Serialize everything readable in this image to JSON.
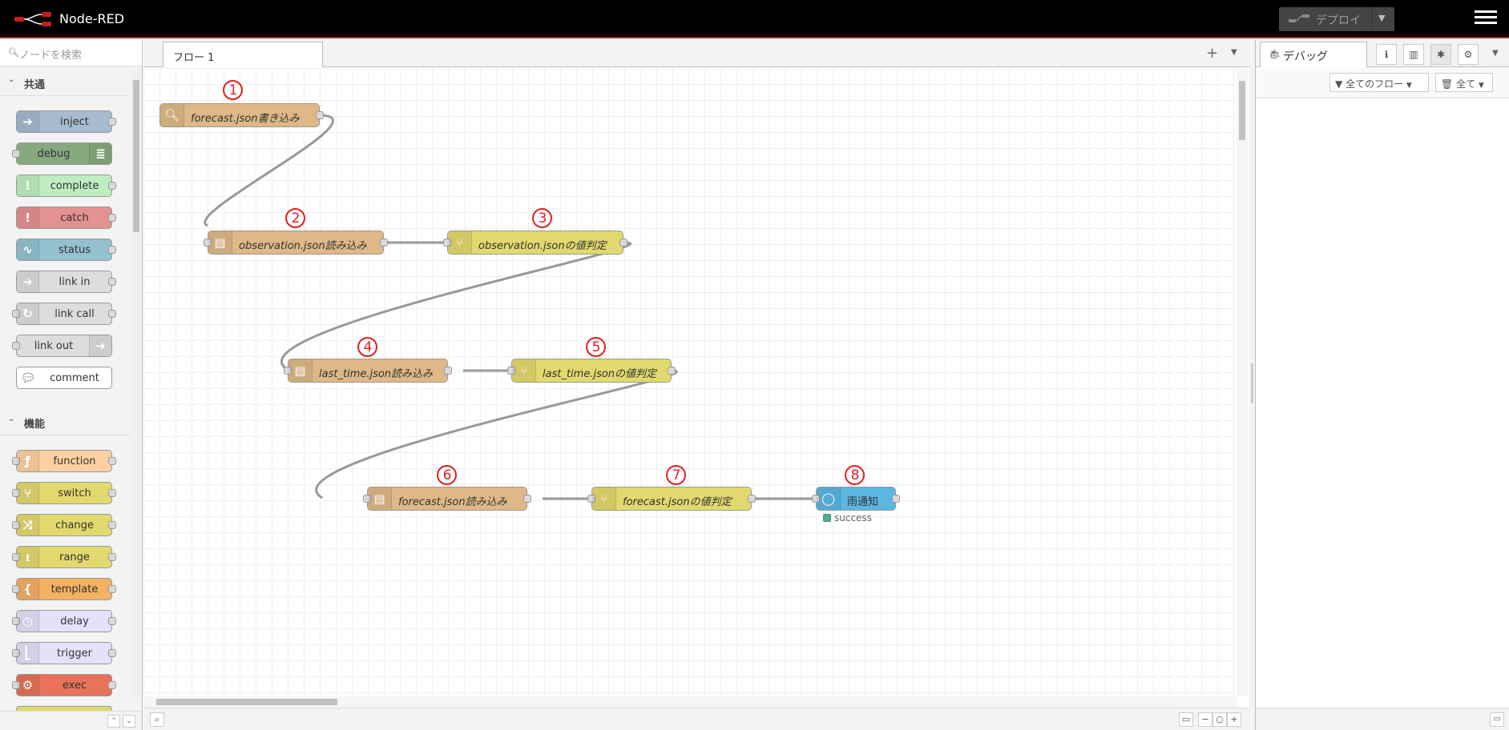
{
  "app": {
    "title": "Node-RED"
  },
  "header": {
    "deploy_label": "デプロイ"
  },
  "palette": {
    "search_placeholder": "ノードを検索",
    "categories": [
      {
        "label": "共通",
        "nodes": [
          {
            "label": "inject",
            "color": "#a6bbcf",
            "icon": "inject-icon"
          },
          {
            "label": "debug",
            "color": "#87a980",
            "icon": "debug-icon"
          },
          {
            "label": "complete",
            "color": "#c0edc0",
            "icon": "alert-icon"
          },
          {
            "label": "catch",
            "color": "#e49191",
            "icon": "alert-icon"
          },
          {
            "label": "status",
            "color": "#94c1d0",
            "icon": "status-icon"
          },
          {
            "label": "link in",
            "color": "#dddddd",
            "icon": "link-in-icon"
          },
          {
            "label": "link call",
            "color": "#dddddd",
            "icon": "link-call-icon"
          },
          {
            "label": "link out",
            "color": "#dddddd",
            "icon": "link-out-icon"
          },
          {
            "label": "comment",
            "color": "#ffffff",
            "icon": "comment-icon"
          }
        ]
      },
      {
        "label": "機能",
        "nodes": [
          {
            "label": "function",
            "color": "#fdd0a2",
            "icon": "function-icon"
          },
          {
            "label": "switch",
            "color": "#e2d96e",
            "icon": "switch-icon"
          },
          {
            "label": "change",
            "color": "#e2d96e",
            "icon": "change-icon"
          },
          {
            "label": "range",
            "color": "#e2d96e",
            "icon": "range-icon"
          },
          {
            "label": "template",
            "color": "#f4b063",
            "icon": "template-icon"
          },
          {
            "label": "delay",
            "color": "#e6e0f8",
            "icon": "timer-icon"
          },
          {
            "label": "trigger",
            "color": "#e6e0f8",
            "icon": "trigger-icon"
          },
          {
            "label": "exec",
            "color": "#e8735a",
            "icon": "cog-icon"
          }
        ]
      }
    ]
  },
  "workspace": {
    "tab_label": "フロー 1"
  },
  "flow": {
    "nodes": [
      {
        "marker": "1",
        "label": "forecast.json書き込み",
        "color": "#deb887"
      },
      {
        "marker": "2",
        "label": "observation.json読み込み",
        "color": "#deb887"
      },
      {
        "marker": "3",
        "label": "observation.jsonの値判定",
        "color": "#e2d96e"
      },
      {
        "marker": "4",
        "label": "last_time.json読み込み",
        "color": "#deb887"
      },
      {
        "marker": "5",
        "label": "last_time.jsonの値判定",
        "color": "#e2d96e"
      },
      {
        "marker": "6",
        "label": "forecast.json読み込み",
        "color": "#deb887"
      },
      {
        "marker": "7",
        "label": "forecast.jsonの値判定",
        "color": "#e2d96e"
      },
      {
        "marker": "8",
        "label": "雨通知",
        "color": "#5bb6e0"
      }
    ],
    "status_text": "success"
  },
  "sidebar": {
    "tab_label": "デバッグ",
    "filter_label": "全てのフロー",
    "clear_label": "全て"
  }
}
